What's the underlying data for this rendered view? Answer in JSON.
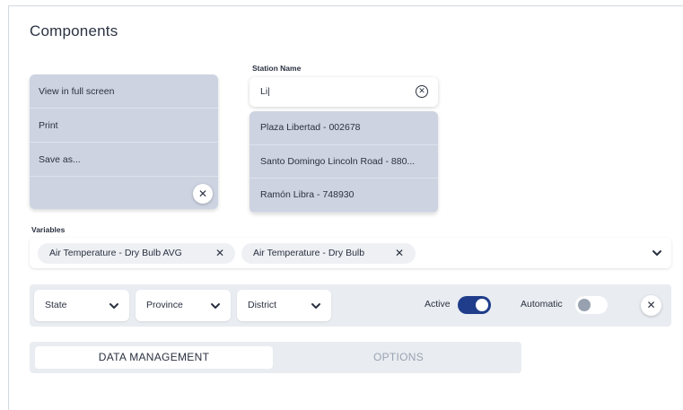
{
  "page": {
    "title": "Components"
  },
  "context_menu": {
    "items": [
      "View in full screen",
      "Print",
      "Save as..."
    ],
    "close_icon": "close-icon"
  },
  "station": {
    "label": "Station Name",
    "input_value": "Li|",
    "clear_icon": "clear-circle-icon",
    "options": [
      "Plaza Libertad - 002678",
      "Santo Domingo Lincoln Road - 880...",
      "Ramón Libra - 748930"
    ]
  },
  "variables": {
    "label": "Variables",
    "chips": [
      "Air Temperature - Dry Bulb AVG",
      "Air Temperature - Dry Bulb"
    ],
    "remove_icon": "close-icon",
    "dropdown_icon": "chevron-down-icon"
  },
  "filters": {
    "selects": [
      "State",
      "Province",
      "District"
    ],
    "active_label": "Active",
    "active_on": true,
    "automatic_label": "Automatic",
    "automatic_on": false
  },
  "tabs": {
    "items": [
      "DATA MANAGEMENT",
      "OPTIONS"
    ],
    "selected": 0
  },
  "colors": {
    "menu_bg": "#cdd3e1",
    "toggle_on": "#1f3d8a",
    "toggle_off": "#ffffff",
    "bar_bg": "#e9ecf1"
  }
}
